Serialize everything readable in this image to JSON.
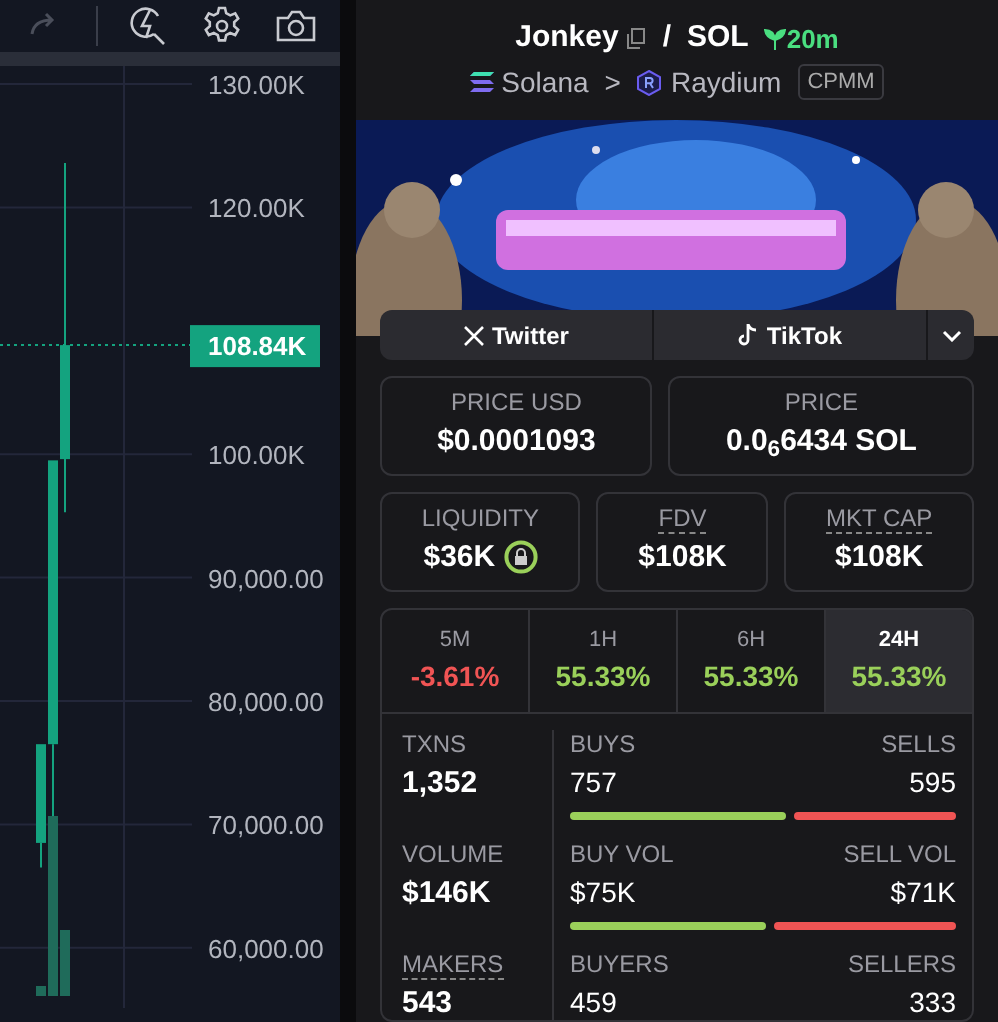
{
  "chart": {
    "y_labels": [
      "130.00K",
      "120.00K",
      "100.00K",
      "90,000.00",
      "80,000.00",
      "70,000.00",
      "60,000.00"
    ],
    "last_price": "108.84K"
  },
  "pair": {
    "base": "Jonkey",
    "separator": "/",
    "quote": "SOL",
    "age": "20m"
  },
  "route": {
    "chain": "Solana",
    "separator": ">",
    "dex": "Raydium",
    "pool_type": "CPMM"
  },
  "socials": [
    {
      "label": "Twitter",
      "kind": "x"
    },
    {
      "label": "TikTok",
      "kind": "tiktok"
    }
  ],
  "price_cards": [
    {
      "label": "PRICE USD",
      "value": "$0.0001093"
    },
    {
      "label": "PRICE",
      "value": "0.0$_{6}$6434 SOL"
    }
  ],
  "metrics": [
    {
      "label": "LIQUIDITY",
      "value": "$36K",
      "locked": true,
      "dotted": false
    },
    {
      "label": "FDV",
      "value": "$108K",
      "locked": false,
      "dotted": true
    },
    {
      "label": "MKT CAP",
      "value": "$108K",
      "locked": false,
      "dotted": true
    }
  ],
  "periods": [
    {
      "label": "5M",
      "change": "-3.61%",
      "falling": true,
      "selected": false
    },
    {
      "label": "1H",
      "change": "55.33%",
      "falling": false,
      "selected": false
    },
    {
      "label": "6H",
      "change": "55.33%",
      "falling": false,
      "selected": false
    },
    {
      "label": "24H",
      "change": "55.33%",
      "falling": false,
      "selected": true
    }
  ],
  "stats": [
    {
      "label": "TXNS",
      "value": "1,352",
      "dotted": false,
      "buy_label": "BUYS",
      "buy_value": "757",
      "sell_label": "SELLS",
      "sell_value": "595",
      "level": 0.56
    },
    {
      "label": "VOLUME",
      "value": "$146K",
      "dotted": false,
      "buy_label": "BUY VOL",
      "buy_value": "$75K",
      "sell_label": "SELL VOL",
      "sell_value": "$71K",
      "level": 0.51
    },
    {
      "label": "MAKERS",
      "value": "543",
      "dotted": true,
      "buy_label": "BUYERS",
      "buy_value": "459",
      "sell_label": "SELLERS",
      "sell_value": "333"
    }
  ]
}
